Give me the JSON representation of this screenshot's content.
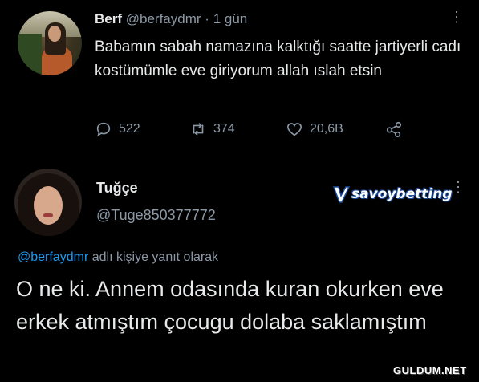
{
  "tweet": {
    "author_name": "Berf",
    "handle": "@berfaydmr",
    "separator": "·",
    "time": "1 gün",
    "more": "⋮",
    "text": "Babamın sabah namazına kalktığı saatte jartiyerli cadı kostümümle eve giriyorum allah ıslah etsin",
    "stats": {
      "replies": "522",
      "retweets": "374",
      "likes": "20,6B"
    },
    "icons": [
      "reply-icon",
      "retweet-icon",
      "heart-icon",
      "share-icon"
    ]
  },
  "reply": {
    "author_name": "Tuğçe",
    "handle": "@Tuge850377772",
    "more": "⋮",
    "replying_to_handle": "@berfaydmr",
    "replying_to_suffix": "adlı kişiye yanıt olarak",
    "text": "O ne ki. Annem odasında kuran okurken eve erkek atmıştım çocugu dolaba saklamıştım"
  },
  "overlay": {
    "sponsor_logo": "savoybetting",
    "watermark": "GULDUM.NET"
  },
  "colors": {
    "background": "#000000",
    "text": "#e7e9ea",
    "secondary": "#8b98a5",
    "mention": "#1d9bf0"
  }
}
